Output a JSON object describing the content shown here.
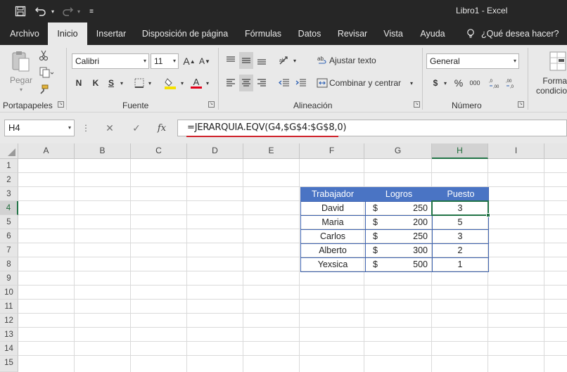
{
  "title_bar": {
    "doc_title": "Libro1  -  Excel",
    "save_icon": "save-icon",
    "undo_icon": "undo-icon",
    "redo_icon": "redo-icon",
    "customize_icon": "customize-quick-access-icon"
  },
  "menu": {
    "tabs": [
      "Archivo",
      "Inicio",
      "Insertar",
      "Disposición de página",
      "Fórmulas",
      "Datos",
      "Revisar",
      "Vista",
      "Ayuda"
    ],
    "active_tab": "Inicio",
    "tell_me": "¿Qué desea hacer?"
  },
  "ribbon": {
    "clipboard": {
      "paste_label": "Pegar",
      "group_label": "Portapapeles"
    },
    "font": {
      "font_name": "Calibri",
      "font_size": "11",
      "grow_label": "A",
      "shrink_label": "A",
      "bold": "N",
      "italic": "K",
      "underline": "S",
      "font_color_label": "A",
      "group_label": "Fuente"
    },
    "alignment": {
      "wrap_text": "Ajustar texto",
      "merge_center": "Combinar y centrar",
      "group_label": "Alineación"
    },
    "number": {
      "format": "General",
      "currency": "$",
      "percent": "%",
      "thousands": "000",
      "group_label": "Número"
    },
    "styles": {
      "conditional_format_line1": "Forma",
      "conditional_format_line2": "condicio"
    }
  },
  "formula_bar": {
    "name_box": "H4",
    "fx": "fx",
    "formula": "=JERARQUIA.EQV(G4,$G$4:$G$8,0)"
  },
  "sheet": {
    "columns": [
      "A",
      "B",
      "C",
      "D",
      "E",
      "F",
      "G",
      "H",
      "I"
    ],
    "selected_column": "H",
    "rows": [
      "1",
      "2",
      "3",
      "4",
      "5",
      "6",
      "7",
      "8",
      "9",
      "10",
      "11",
      "12",
      "13",
      "14",
      "15"
    ],
    "selected_row": "4",
    "active_cell": "H4",
    "table": {
      "headers": [
        "Trabajador",
        "Logros",
        "Puesto"
      ],
      "rows": [
        {
          "name": "David",
          "currency": "$",
          "amount": "250",
          "rank": "3"
        },
        {
          "name": "Maria",
          "currency": "$",
          "amount": "200",
          "rank": "5"
        },
        {
          "name": "Carlos",
          "currency": "$",
          "amount": "250",
          "rank": "3"
        },
        {
          "name": "Alberto",
          "currency": "$",
          "amount": "300",
          "rank": "2"
        },
        {
          "name": "Yexsica",
          "currency": "$",
          "amount": "500",
          "rank": "1"
        }
      ]
    }
  },
  "colors": {
    "title_bar": "#262626",
    "ribbon": "#e9e9e9",
    "table_header": "#4a74c4",
    "table_border": "#3f64b0",
    "selection": "#217346",
    "formula_underline": "#d0222a"
  }
}
